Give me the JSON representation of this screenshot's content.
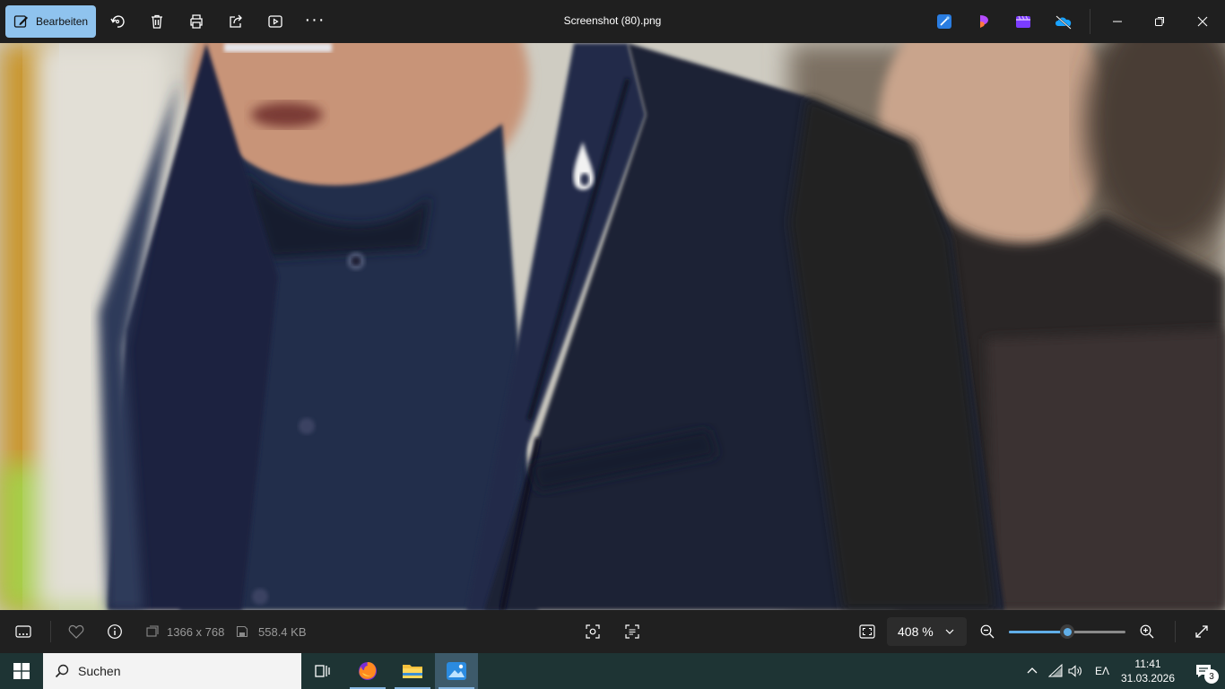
{
  "titlebar": {
    "edit_label": "Bearbeiten",
    "file_title": "Screenshot (80).png",
    "more_label": "···",
    "icons": [
      "edit-icon",
      "rotate-icon",
      "delete-icon",
      "print-icon",
      "share-icon",
      "slideshow-icon",
      "more-icon"
    ],
    "app_icons": [
      "designer-icon",
      "clipchamp-icon",
      "video-editor-icon",
      "onedrive-icon"
    ],
    "window_controls": [
      "minimize-icon",
      "restore-icon",
      "close-icon"
    ]
  },
  "viewport": {
    "description_icon": "photo"
  },
  "bottombar": {
    "dimensions": "1366 x 768",
    "file_size": "558.4 KB",
    "zoom_value": "408 %",
    "zoom_level_fraction": 0.5,
    "icons": [
      "filmstrip-icon",
      "favorite-icon",
      "info-icon",
      "dimensions-icon",
      "save-icon",
      "visual-search-icon",
      "text-scan-icon",
      "fit-window-icon",
      "zoom-out-icon",
      "zoom-in-icon",
      "fullscreen-icon"
    ]
  },
  "taskbar": {
    "search_placeholder": "Suchen",
    "apps": [
      "task-view-icon",
      "firefox-icon",
      "file-explorer-icon",
      "photos-icon"
    ],
    "language": "EΛ",
    "time": "11:41",
    "date": "31.03.2026",
    "notification_count": "3"
  },
  "colors": {
    "accent": "#8fc3ee",
    "slider": "#60aee8",
    "taskbar": "#1e3434"
  }
}
